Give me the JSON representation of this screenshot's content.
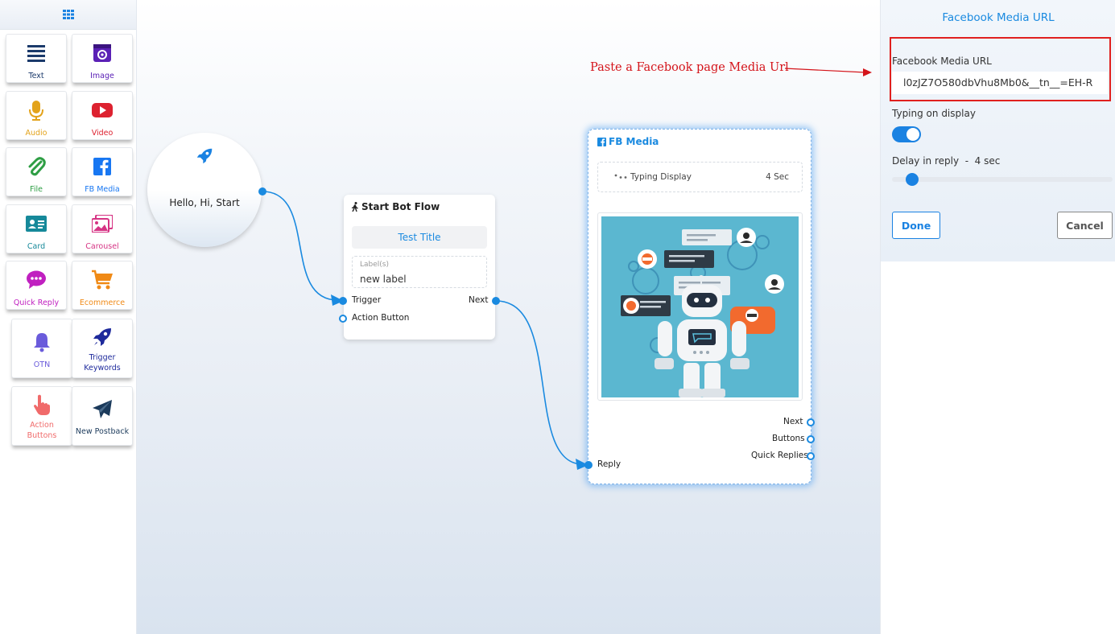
{
  "sidebar": {
    "items": [
      {
        "label": "Text",
        "color": "#1b3a6b",
        "icon": "text-lines-icon"
      },
      {
        "label": "Image",
        "color": "#5b21b6",
        "icon": "image-icon"
      },
      {
        "label": "Audio",
        "color": "#e3a31b",
        "icon": "microphone-icon"
      },
      {
        "label": "Video",
        "color": "#dd2230",
        "icon": "youtube-icon"
      },
      {
        "label": "File",
        "color": "#2e9e44",
        "icon": "paperclip-icon"
      },
      {
        "label": "FB Media",
        "color": "#1877f2",
        "icon": "facebook-icon"
      },
      {
        "label": "Card",
        "color": "#16899a",
        "icon": "id-card-icon"
      },
      {
        "label": "Carousel",
        "color": "#d63384",
        "icon": "images-icon"
      },
      {
        "label": "Quick Reply",
        "color": "#c020c0",
        "icon": "chat-bubble-icon"
      },
      {
        "label": "Ecommerce",
        "color": "#f08a16",
        "icon": "cart-icon"
      },
      {
        "label": "OTN",
        "color": "#6a5bdb",
        "icon": "bell-icon"
      },
      {
        "label": "Trigger Keywords",
        "color": "#1e2a9c",
        "icon": "rocket-icon"
      },
      {
        "label": "Action Buttons",
        "color": "#f06a6a",
        "icon": "pointer-hand-icon"
      },
      {
        "label": "New Postback",
        "color": "#1b3a5b",
        "icon": "paper-plane-icon"
      }
    ]
  },
  "canvas": {
    "start_node": {
      "text": "Hello, Hi, Start"
    },
    "bot_flow": {
      "title": "Start Bot Flow",
      "test_title": "Test Title",
      "label_caption": "Label(s)",
      "label_value": "new label",
      "trigger": "Trigger",
      "action_button": "Action Button",
      "next": "Next"
    },
    "fb_media": {
      "title": "FB Media",
      "typing_label": "Typing Display",
      "typing_value": "4 Sec",
      "ports": {
        "next": "Next",
        "buttons": "Buttons",
        "quick_replies": "Quick Replies",
        "reply": "Reply"
      }
    }
  },
  "annotation": {
    "text": "Paste a Facebook page Media Url"
  },
  "panel": {
    "title": "Facebook Media URL",
    "url_label": "Facebook Media URL",
    "url_value": "l0zJZ7O580dbVhu8Mb0&__tn__=EH-R",
    "typing_label": "Typing on display",
    "typing_enabled": true,
    "delay_label": "Delay in reply  -  4 sec",
    "delay_value": 4,
    "done": "Done",
    "cancel": "Cancel"
  },
  "colors": {
    "accent": "#1a82e2",
    "highlight": "#e0201e"
  }
}
